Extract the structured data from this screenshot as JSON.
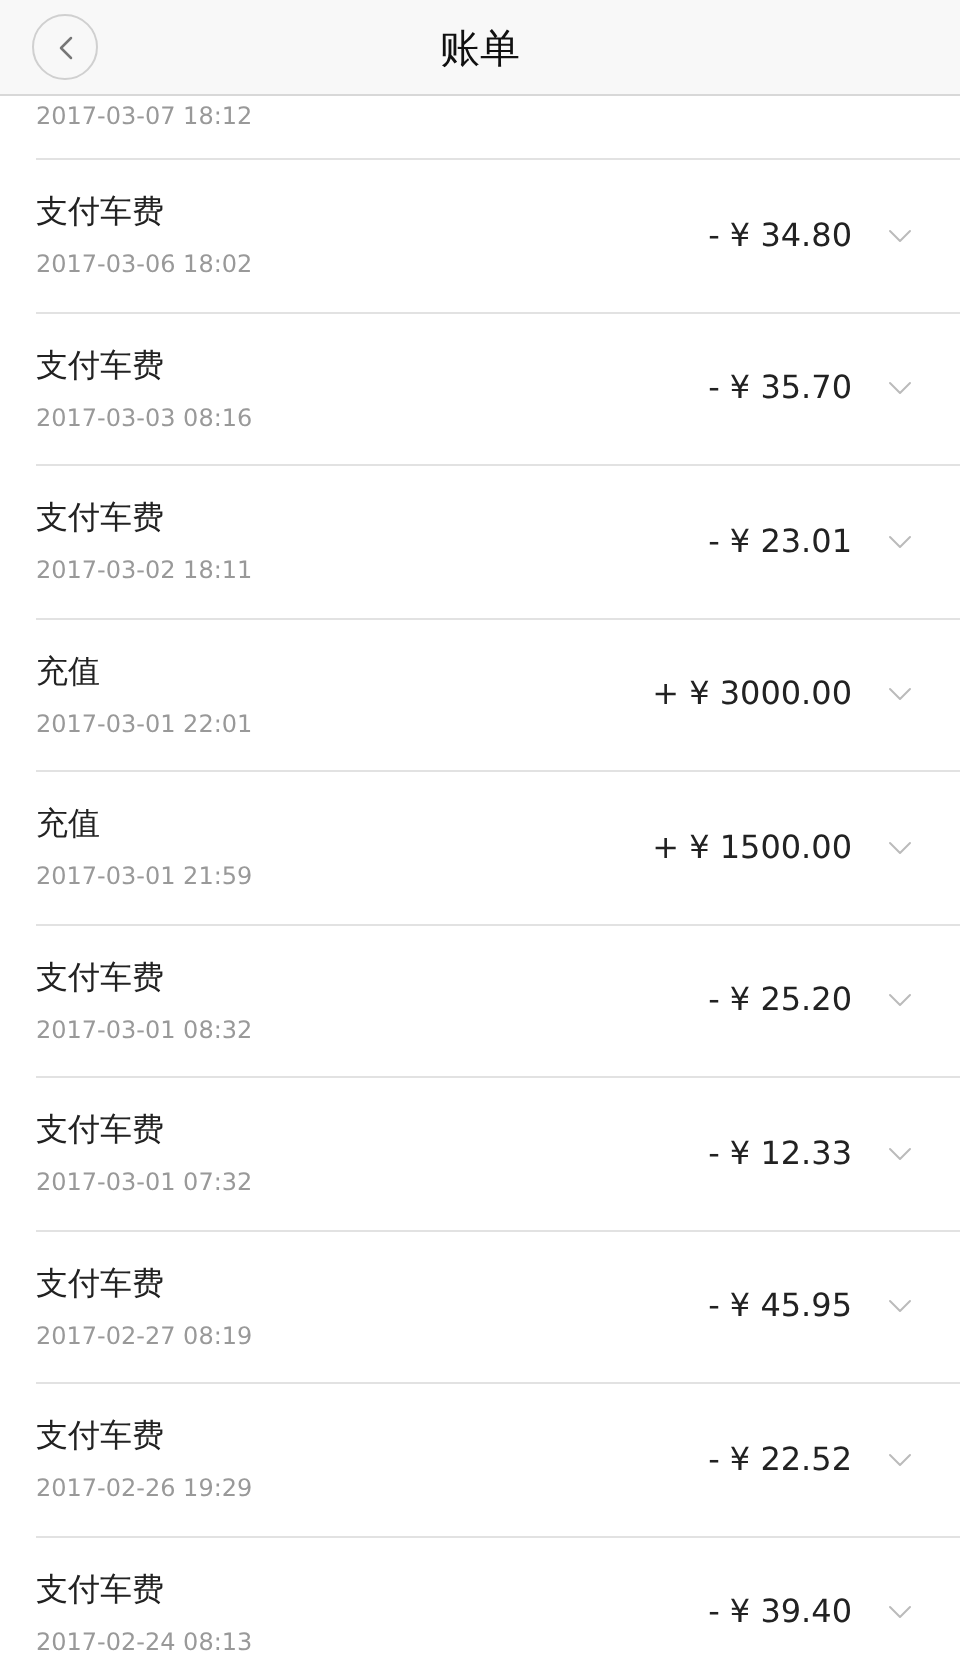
{
  "header": {
    "title": "账单"
  },
  "partial_row": {
    "date": "2017-03-07 18:12"
  },
  "rows": [
    {
      "title": "支付车费",
      "date": "2017-03-06 18:02",
      "amount": "- ¥ 34.80"
    },
    {
      "title": "支付车费",
      "date": "2017-03-03 08:16",
      "amount": "- ¥ 35.70"
    },
    {
      "title": "支付车费",
      "date": "2017-03-02 18:11",
      "amount": "- ¥ 23.01"
    },
    {
      "title": "充值",
      "date": "2017-03-01 22:01",
      "amount": "+ ¥ 3000.00"
    },
    {
      "title": "充值",
      "date": "2017-03-01 21:59",
      "amount": "+ ¥ 1500.00"
    },
    {
      "title": "支付车费",
      "date": "2017-03-01 08:32",
      "amount": "- ¥ 25.20"
    },
    {
      "title": "支付车费",
      "date": "2017-03-01 07:32",
      "amount": "- ¥ 12.33"
    },
    {
      "title": "支付车费",
      "date": "2017-02-27 08:19",
      "amount": "- ¥ 45.95"
    },
    {
      "title": "支付车费",
      "date": "2017-02-26 19:29",
      "amount": "- ¥ 22.52"
    },
    {
      "title": "支付车费",
      "date": "2017-02-24 08:13",
      "amount": "- ¥ 39.40"
    }
  ]
}
